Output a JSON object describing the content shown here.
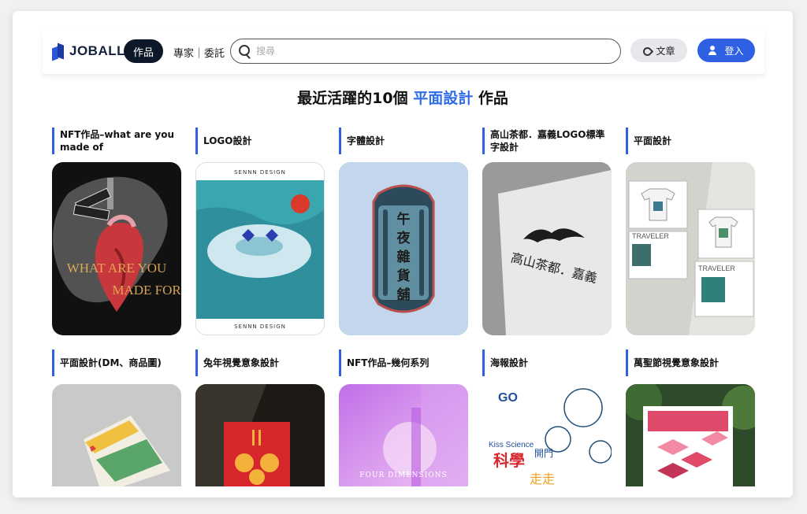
{
  "header": {
    "logo_text": "JOBALL",
    "nav_works": "作品",
    "nav_experts": "專家｜委託",
    "search_placeholder": "搜尋",
    "articles_label": "文章",
    "login_label": "登入"
  },
  "heading": {
    "prefix": "最近活躍的10個",
    "highlight": "平面設計",
    "suffix": "作品"
  },
  "works": [
    {
      "title": "NFT作品–what are you made of",
      "thumb_text": "WHAT ARE YOU MADE FOR"
    },
    {
      "title": "LOGO設計",
      "thumb_text_top": "SENNN DESIGN",
      "thumb_text_bottom": "SENNN DESIGN"
    },
    {
      "title": "字體設計",
      "thumb_text": "午夜雜貨舖"
    },
    {
      "title": "高山茶都．嘉義LOGO標準字設計",
      "thumb_text": "高山茶都．嘉義"
    },
    {
      "title": "平面設計",
      "thumb_text": "TRAVELER"
    },
    {
      "title": "平面設計(DM、商品圖)"
    },
    {
      "title": "兔年視覺意象設計"
    },
    {
      "title": "NFT作品–幾何系列",
      "thumb_text": "FOUR DIMENSIONS"
    },
    {
      "title": "海報設計",
      "thumb_text": "Kiss Science 科學開門"
    },
    {
      "title": "萬聖節視覺意象設計"
    }
  ],
  "colors": {
    "brand_blue": "#2f5fe3",
    "highlight_blue": "#2f6ce5",
    "dark_button": "#0c1727"
  }
}
